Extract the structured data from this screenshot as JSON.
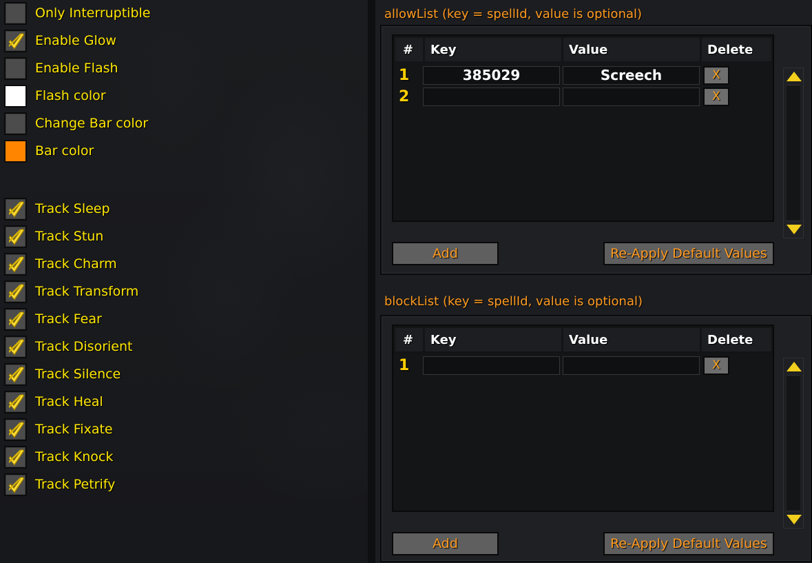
{
  "left_panel": {
    "options_group_1": [
      {
        "label": "Only Interruptible",
        "control": "checkbox",
        "checked": false
      },
      {
        "label": "Enable Glow",
        "control": "checkbox",
        "checked": true
      },
      {
        "label": "Enable Flash",
        "control": "checkbox",
        "checked": false
      },
      {
        "label": "Flash color",
        "control": "color-swatch",
        "color": "#ffffff"
      },
      {
        "label": "Change Bar color",
        "control": "checkbox",
        "checked": false
      },
      {
        "label": "Bar color",
        "control": "color-swatch",
        "color": "#ff8400"
      }
    ],
    "options_group_2": [
      {
        "label": "Track Sleep",
        "control": "checkbox",
        "checked": true
      },
      {
        "label": "Track Stun",
        "control": "checkbox",
        "checked": true
      },
      {
        "label": "Track Charm",
        "control": "checkbox",
        "checked": true
      },
      {
        "label": "Track Transform",
        "control": "checkbox",
        "checked": true
      },
      {
        "label": "Track Fear",
        "control": "checkbox",
        "checked": true
      },
      {
        "label": "Track Disorient",
        "control": "checkbox",
        "checked": true
      },
      {
        "label": "Track Silence",
        "control": "checkbox",
        "checked": true
      },
      {
        "label": "Track Heal",
        "control": "checkbox",
        "checked": true
      },
      {
        "label": "Track Fixate",
        "control": "checkbox",
        "checked": true
      },
      {
        "label": "Track Knock",
        "control": "checkbox",
        "checked": true
      },
      {
        "label": "Track Petrify",
        "control": "checkbox",
        "checked": true
      }
    ]
  },
  "right_panel": {
    "allow_list": {
      "title": "allowList (key = spellId, value is optional)",
      "columns": [
        "#",
        "Key",
        "Value",
        "Delete"
      ],
      "rows": [
        {
          "num": "1",
          "key": "385029",
          "value": "Screech",
          "delete_label": "X"
        },
        {
          "num": "2",
          "key": "",
          "value": "",
          "delete_label": "X"
        }
      ],
      "add_label": "Add",
      "reapply_label": "Re-Apply Default Values",
      "scroll_up_icon": "triangle-up-icon",
      "scroll_down_icon": "triangle-down-icon"
    },
    "block_list": {
      "title": "blockList (key = spellId, value is optional)",
      "columns": [
        "#",
        "Key",
        "Value",
        "Delete"
      ],
      "rows": [
        {
          "num": "1",
          "key": "",
          "value": "",
          "delete_label": "X"
        }
      ],
      "add_label": "Add",
      "reapply_label": "Re-Apply Default Values",
      "scroll_up_icon": "triangle-up-icon",
      "scroll_down_icon": "triangle-down-icon"
    }
  },
  "colors": {
    "label_yellow": "#ffe700",
    "header_orange": "#ff9b21",
    "row_number_gold": "#ffd000",
    "bar_color_orange": "#ff8400",
    "flash_color_white": "#ffffff",
    "background": "#1a1b1d"
  }
}
